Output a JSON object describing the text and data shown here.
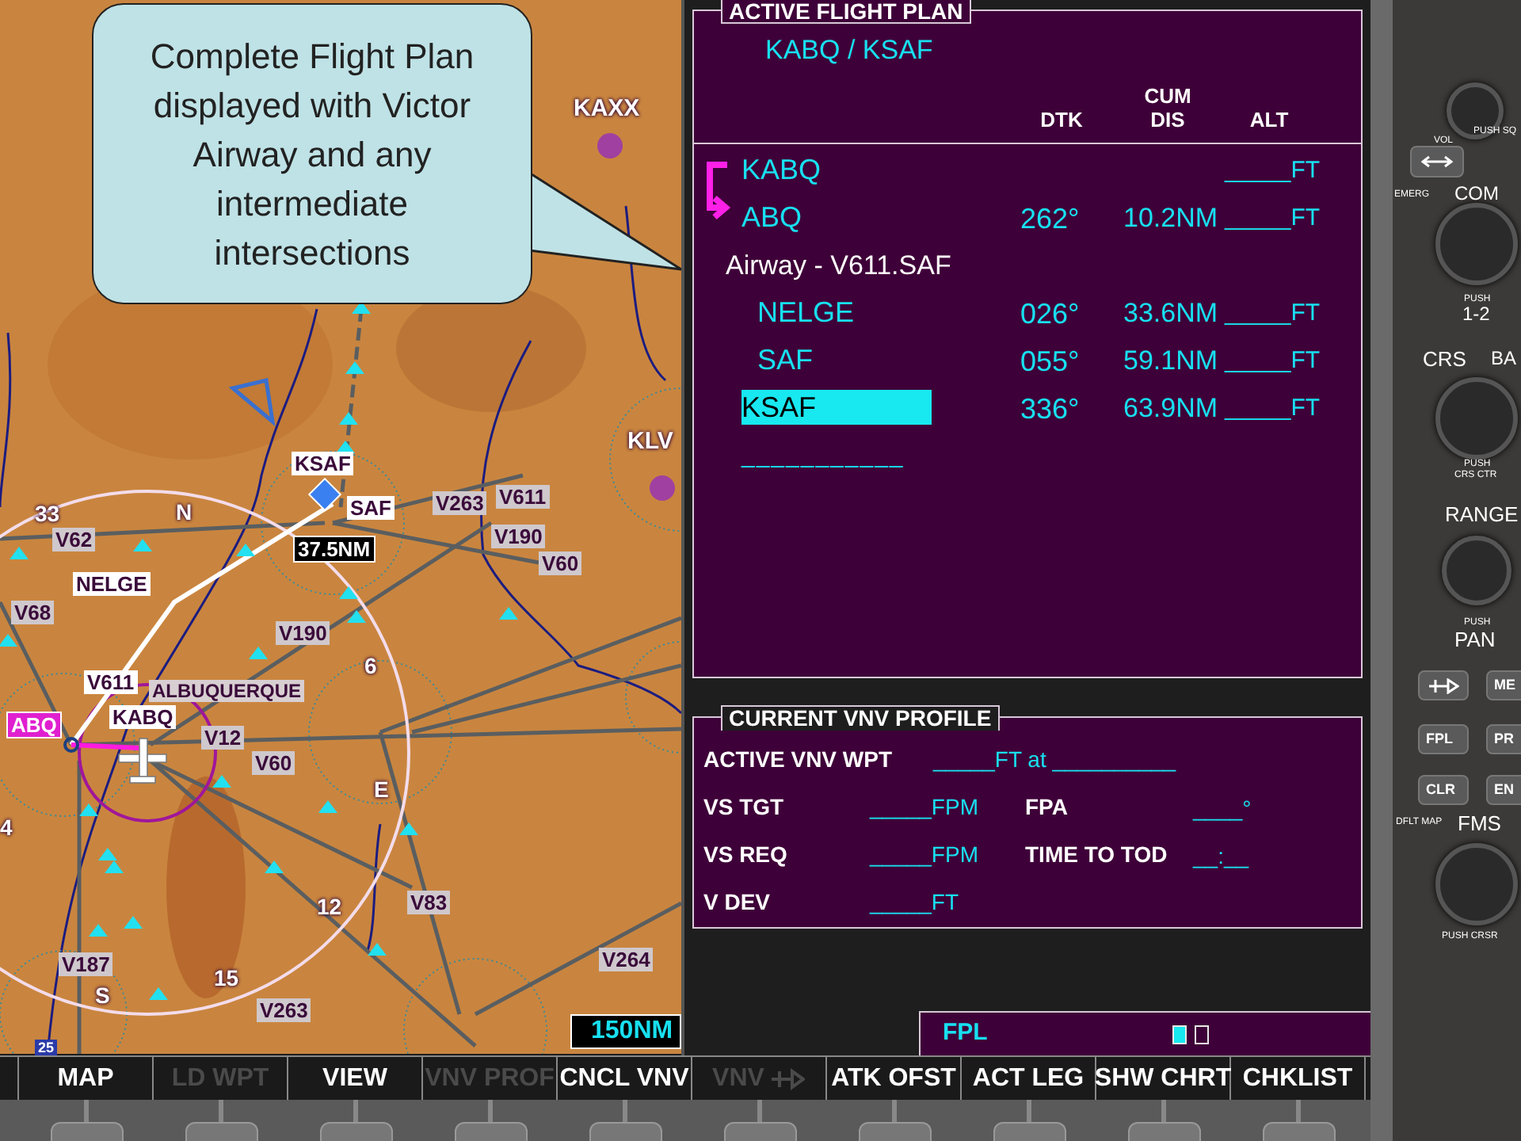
{
  "callout": {
    "text": "Complete Flight Plan displayed with Victor Airway and any intermediate intersections"
  },
  "map": {
    "labels": [
      {
        "text": "KAXX",
        "kind": "airport"
      },
      {
        "text": "KLV",
        "kind": "airport"
      },
      {
        "text": "KSAF",
        "kind": "waypoint"
      },
      {
        "text": "SAF",
        "kind": "waypoint"
      },
      {
        "text": "V263",
        "kind": "airway"
      },
      {
        "text": "V611",
        "kind": "airway"
      },
      {
        "text": "V190",
        "kind": "airway"
      },
      {
        "text": "V60",
        "kind": "airway"
      },
      {
        "text": "33",
        "kind": "compass"
      },
      {
        "text": "V62",
        "kind": "airway"
      },
      {
        "text": "N",
        "kind": "compass"
      },
      {
        "text": "37.5NM",
        "kind": "range"
      },
      {
        "text": "NELGE",
        "kind": "waypoint"
      },
      {
        "text": "V68",
        "kind": "airway"
      },
      {
        "text": "V190",
        "kind": "airway"
      },
      {
        "text": "6",
        "kind": "compass"
      },
      {
        "text": "V611",
        "kind": "waypoint"
      },
      {
        "text": "ALBUQUERQUE",
        "kind": "city"
      },
      {
        "text": "ABQ",
        "kind": "active"
      },
      {
        "text": "KABQ",
        "kind": "waypoint"
      },
      {
        "text": "V12",
        "kind": "airway"
      },
      {
        "text": "V60",
        "kind": "airway"
      },
      {
        "text": "E",
        "kind": "compass"
      },
      {
        "text": "4",
        "kind": "compass"
      },
      {
        "text": "12",
        "kind": "compass"
      },
      {
        "text": "V83",
        "kind": "airway"
      },
      {
        "text": "V264",
        "kind": "airway"
      },
      {
        "text": "V187",
        "kind": "airway"
      },
      {
        "text": "15",
        "kind": "compass"
      },
      {
        "text": "S",
        "kind": "compass"
      },
      {
        "text": "V263",
        "kind": "airway"
      },
      {
        "text": "150NM",
        "kind": "scale"
      },
      {
        "text": "25",
        "kind": "highway"
      }
    ]
  },
  "flight_plan": {
    "title": "ACTIVE FLIGHT PLAN",
    "route": "KABQ / KSAF",
    "columns": [
      "DTK",
      "CUM DIS",
      "ALT"
    ],
    "legs": [
      {
        "kind": "waypoint",
        "name": "KABQ",
        "alt": "_____FT",
        "active": false,
        "selected": false
      },
      {
        "kind": "waypoint",
        "name": "ABQ",
        "dtk": "262°",
        "dis": "10.2NM",
        "alt": "_____FT",
        "active": true,
        "selected": false
      },
      {
        "kind": "airway",
        "name": "Airway - V611.SAF",
        "selected": false,
        "children": [
          {
            "kind": "waypoint",
            "name": "NELGE",
            "dtk": "026°",
            "dis": "33.6NM",
            "alt": "_____FT",
            "active": false,
            "selected": false
          },
          {
            "kind": "waypoint",
            "name": "SAF",
            "dtk": "055°",
            "dis": "59.1NM",
            "alt": "_____FT",
            "active": false,
            "selected": false
          }
        ]
      },
      {
        "kind": "waypoint",
        "name": "KSAF",
        "dtk": "336°",
        "dis": "63.9NM",
        "alt": "_____FT",
        "active": false,
        "selected": true
      },
      {
        "kind": "empty",
        "name": "___________",
        "selected": false
      }
    ]
  },
  "vnv_profile": {
    "title": "CURRENT VNV PROFILE",
    "rows": [
      {
        "label": "ACTIVE VNV WPT",
        "value": "_____FT at __________"
      },
      {
        "label": "VS TGT",
        "value": "_____FPM",
        "label_2": "FPA",
        "value_2": "____°"
      },
      {
        "label": "VS REQ",
        "value": "_____FPM",
        "label_2": "TIME TO TOD",
        "value_2": "__:__"
      },
      {
        "label": "V DEV",
        "value": "_____FT"
      }
    ]
  },
  "page_group": {
    "label": "FPL",
    "pages": [
      {
        "selected": true
      },
      {
        "selected": false
      }
    ]
  },
  "softkeys": [
    {
      "label": "MAP",
      "kind": "text",
      "disabled": false
    },
    {
      "label": "LD WPT",
      "kind": "text",
      "disabled": true
    },
    {
      "label": "VIEW",
      "kind": "text",
      "disabled": false
    },
    {
      "label": "VNV PROF",
      "kind": "text",
      "disabled": true
    },
    {
      "label": "CNCL VNV",
      "kind": "text",
      "disabled": false
    },
    {
      "label": "VNV",
      "kind": "direct",
      "disabled": true
    },
    {
      "label": "ATK OFST",
      "kind": "text",
      "disabled": false
    },
    {
      "label": "ACT LEG",
      "kind": "text",
      "disabled": false
    },
    {
      "label": "SHW CHRT",
      "kind": "text",
      "disabled": false
    },
    {
      "label": "CHKLIST",
      "kind": "text",
      "disabled": false
    }
  ],
  "bezel": {
    "buttons": [
      {
        "label": "ME"
      },
      {
        "label": "FPL"
      },
      {
        "label": "PR"
      },
      {
        "label": "CLR"
      },
      {
        "label": "EN"
      }
    ],
    "labels": [
      "VOL",
      "PUSH SQ",
      "EMERG",
      "COM",
      "PUSH",
      "1-2",
      "CRS",
      "BA",
      "PUSH",
      "CRS CTR",
      "RANGE",
      "PUSH",
      "PAN",
      "DFLT MAP",
      "FMS",
      "PUSH CRSR"
    ]
  }
}
